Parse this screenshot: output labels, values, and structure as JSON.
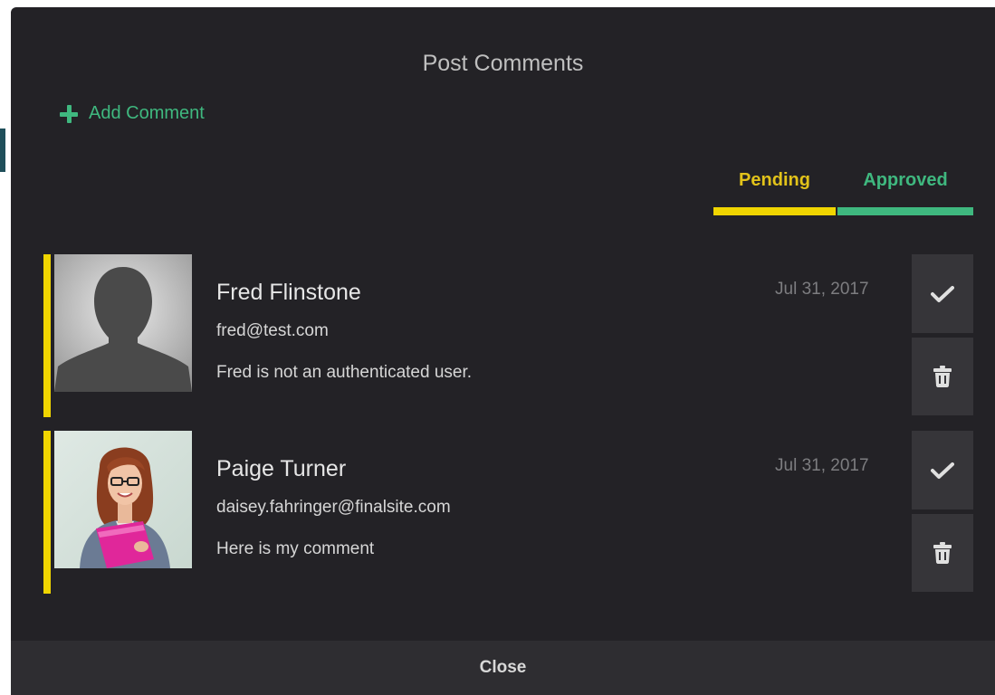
{
  "modal": {
    "title": "Post Comments",
    "add_comment_label": "Add Comment",
    "close_label": "Close"
  },
  "tabs": [
    {
      "label": "Pending",
      "color": "#e2c31a",
      "active": true
    },
    {
      "label": "Approved",
      "color": "#3fb87f",
      "active": false
    }
  ],
  "comments": [
    {
      "name": "Fred Flinstone",
      "email": "fred@test.com",
      "text": "Fred is not an authenticated user.",
      "date": "Jul 31, 2017",
      "avatar": "silhouette-avatar"
    },
    {
      "name": "Paige Turner",
      "email": "daisey.fahringer@finalsite.com",
      "text": "Here is my comment",
      "date": "Jul 31, 2017",
      "avatar": "photo-avatar"
    }
  ],
  "icons": {
    "approve": "checkmark-icon",
    "delete": "trash-icon",
    "add": "plus-icon"
  },
  "colors": {
    "modal_bg": "#232226",
    "accent_green": "#3fb87f",
    "pending_yellow": "#f0d500",
    "button_bg": "#363539"
  }
}
